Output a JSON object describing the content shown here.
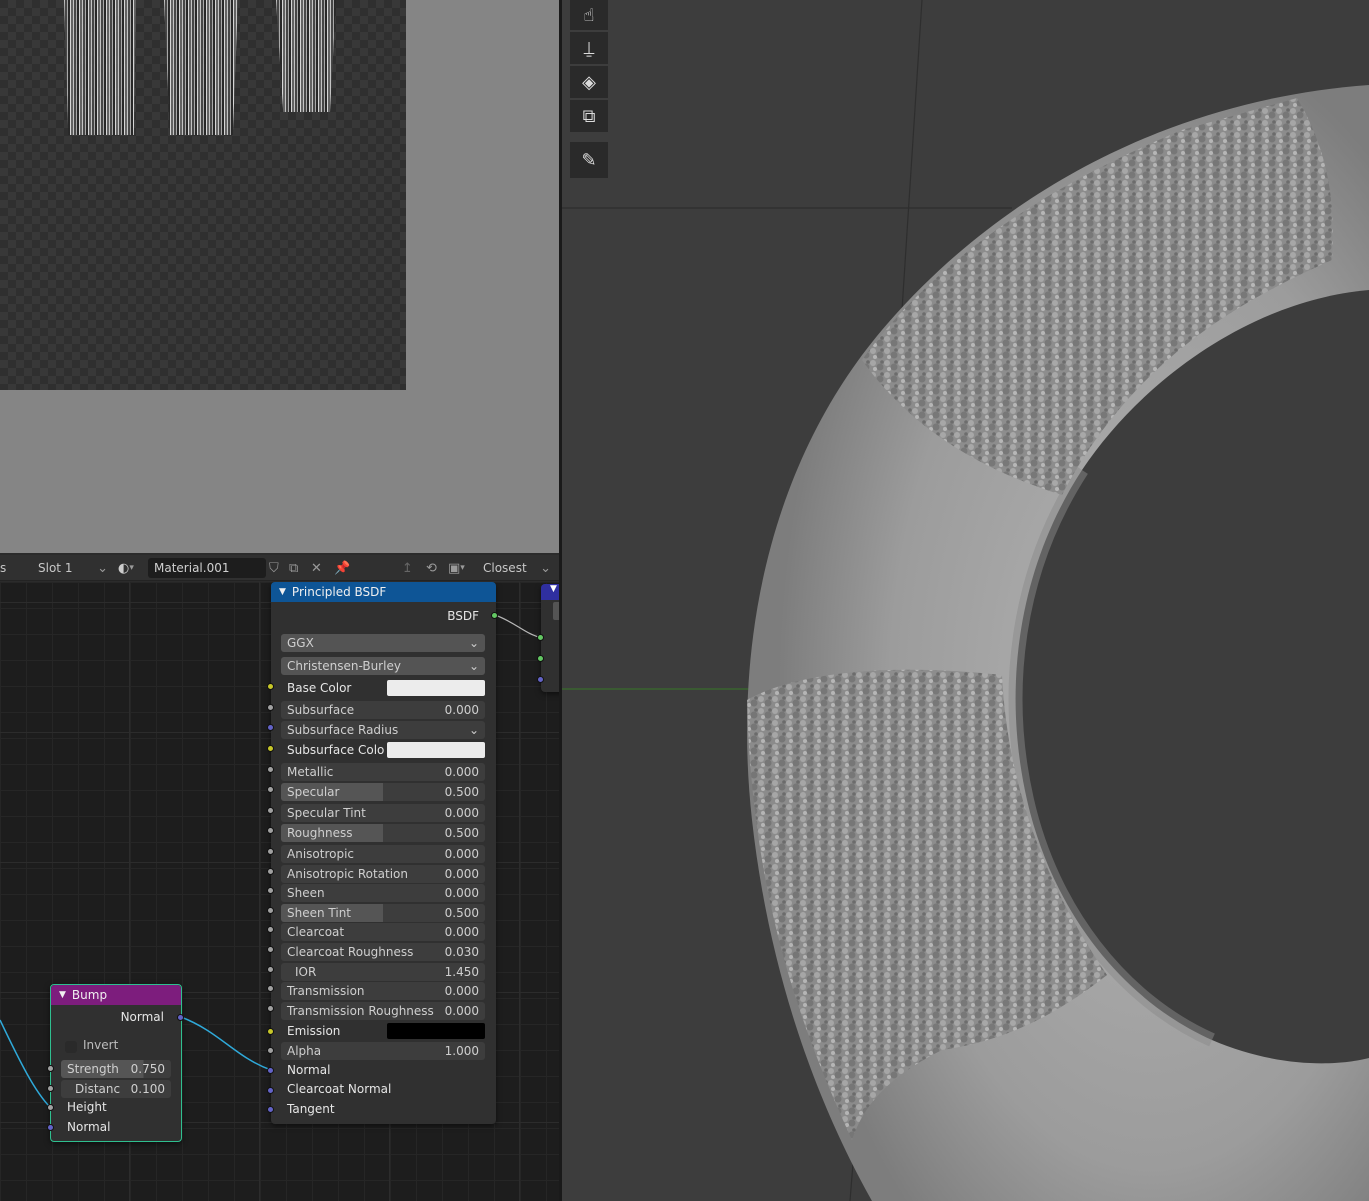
{
  "node_header": {
    "left_label": "s",
    "slot": "Slot 1",
    "material_name": "Material.001",
    "interpolation": "Closest"
  },
  "principled_node": {
    "title": "Principled BSDF",
    "output": "BSDF",
    "distribution": "GGX",
    "subsurface_method": "Christensen-Burley",
    "inputs": {
      "base_color": "Base Color",
      "subsurface": {
        "label": "Subsurface",
        "value": "0.000"
      },
      "subsurface_radius": "Subsurface Radius",
      "subsurface_color": "Subsurface Colo",
      "metallic": {
        "label": "Metallic",
        "value": "0.000"
      },
      "specular": {
        "label": "Specular",
        "value": "0.500"
      },
      "specular_tint": {
        "label": "Specular Tint",
        "value": "0.000"
      },
      "roughness": {
        "label": "Roughness",
        "value": "0.500"
      },
      "anisotropic": {
        "label": "Anisotropic",
        "value": "0.000"
      },
      "anisotropic_rotation": {
        "label": "Anisotropic Rotation",
        "value": "0.000"
      },
      "sheen": {
        "label": "Sheen",
        "value": "0.000"
      },
      "sheen_tint": {
        "label": "Sheen Tint",
        "value": "0.500"
      },
      "clearcoat": {
        "label": "Clearcoat",
        "value": "0.000"
      },
      "clearcoat_roughness": {
        "label": "Clearcoat Roughness",
        "value": "0.030"
      },
      "ior": {
        "label": "IOR",
        "value": "1.450"
      },
      "transmission": {
        "label": "Transmission",
        "value": "0.000"
      },
      "transmission_roughness": {
        "label": "Transmission Roughness",
        "value": "0.000"
      },
      "emission": "Emission",
      "alpha": {
        "label": "Alpha",
        "value": "1.000"
      },
      "normal": "Normal",
      "clearcoat_normal": "Clearcoat Normal",
      "tangent": "Tangent"
    },
    "colors": {
      "header": "#0e5596",
      "base_color": "#ececec",
      "subsurface_color": "#ececec",
      "emission": "#000000"
    }
  },
  "bump_node": {
    "title": "Bump",
    "output": "Normal",
    "invert": "Invert",
    "strength": {
      "label": "Strength",
      "value": "0.750"
    },
    "distance": {
      "label": "Distanc",
      "value": "0.100"
    },
    "height": "Height",
    "normal_in": "Normal",
    "colors": {
      "header": "#7d1d7d",
      "border": "#2fbf8f"
    }
  },
  "tools": [
    "smear-brush-icon",
    "clone-stamp-icon",
    "fill-bucket-icon",
    "mask-icon",
    "annotate-icon"
  ],
  "colors": {
    "link": "#2fa9d9",
    "viewport_bg": "#3d3d3d",
    "torus": "#9a9a9a"
  }
}
